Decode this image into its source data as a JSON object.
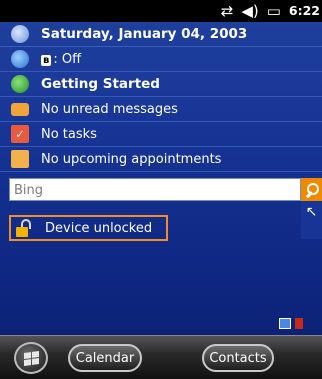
{
  "status": {
    "time": "6:22",
    "icons": [
      "data-transfer-icon",
      "volume-icon",
      "battery-icon"
    ]
  },
  "today": {
    "date": "Saturday, January 04, 2003",
    "bluetooth_badge": "Ƀ",
    "wireless_status": ": Off",
    "getting_started": "Getting Started",
    "messages": "No unread messages",
    "tasks": "No tasks",
    "appointments": "No upcoming appointments",
    "search_placeholder": "Bing",
    "lock_status": "Device unlocked"
  },
  "softkeys": {
    "left": "Calendar",
    "right": "Contacts"
  },
  "colors": {
    "background": "#173596",
    "accent": "#f08a00",
    "highlight_border": "#f28c28"
  }
}
